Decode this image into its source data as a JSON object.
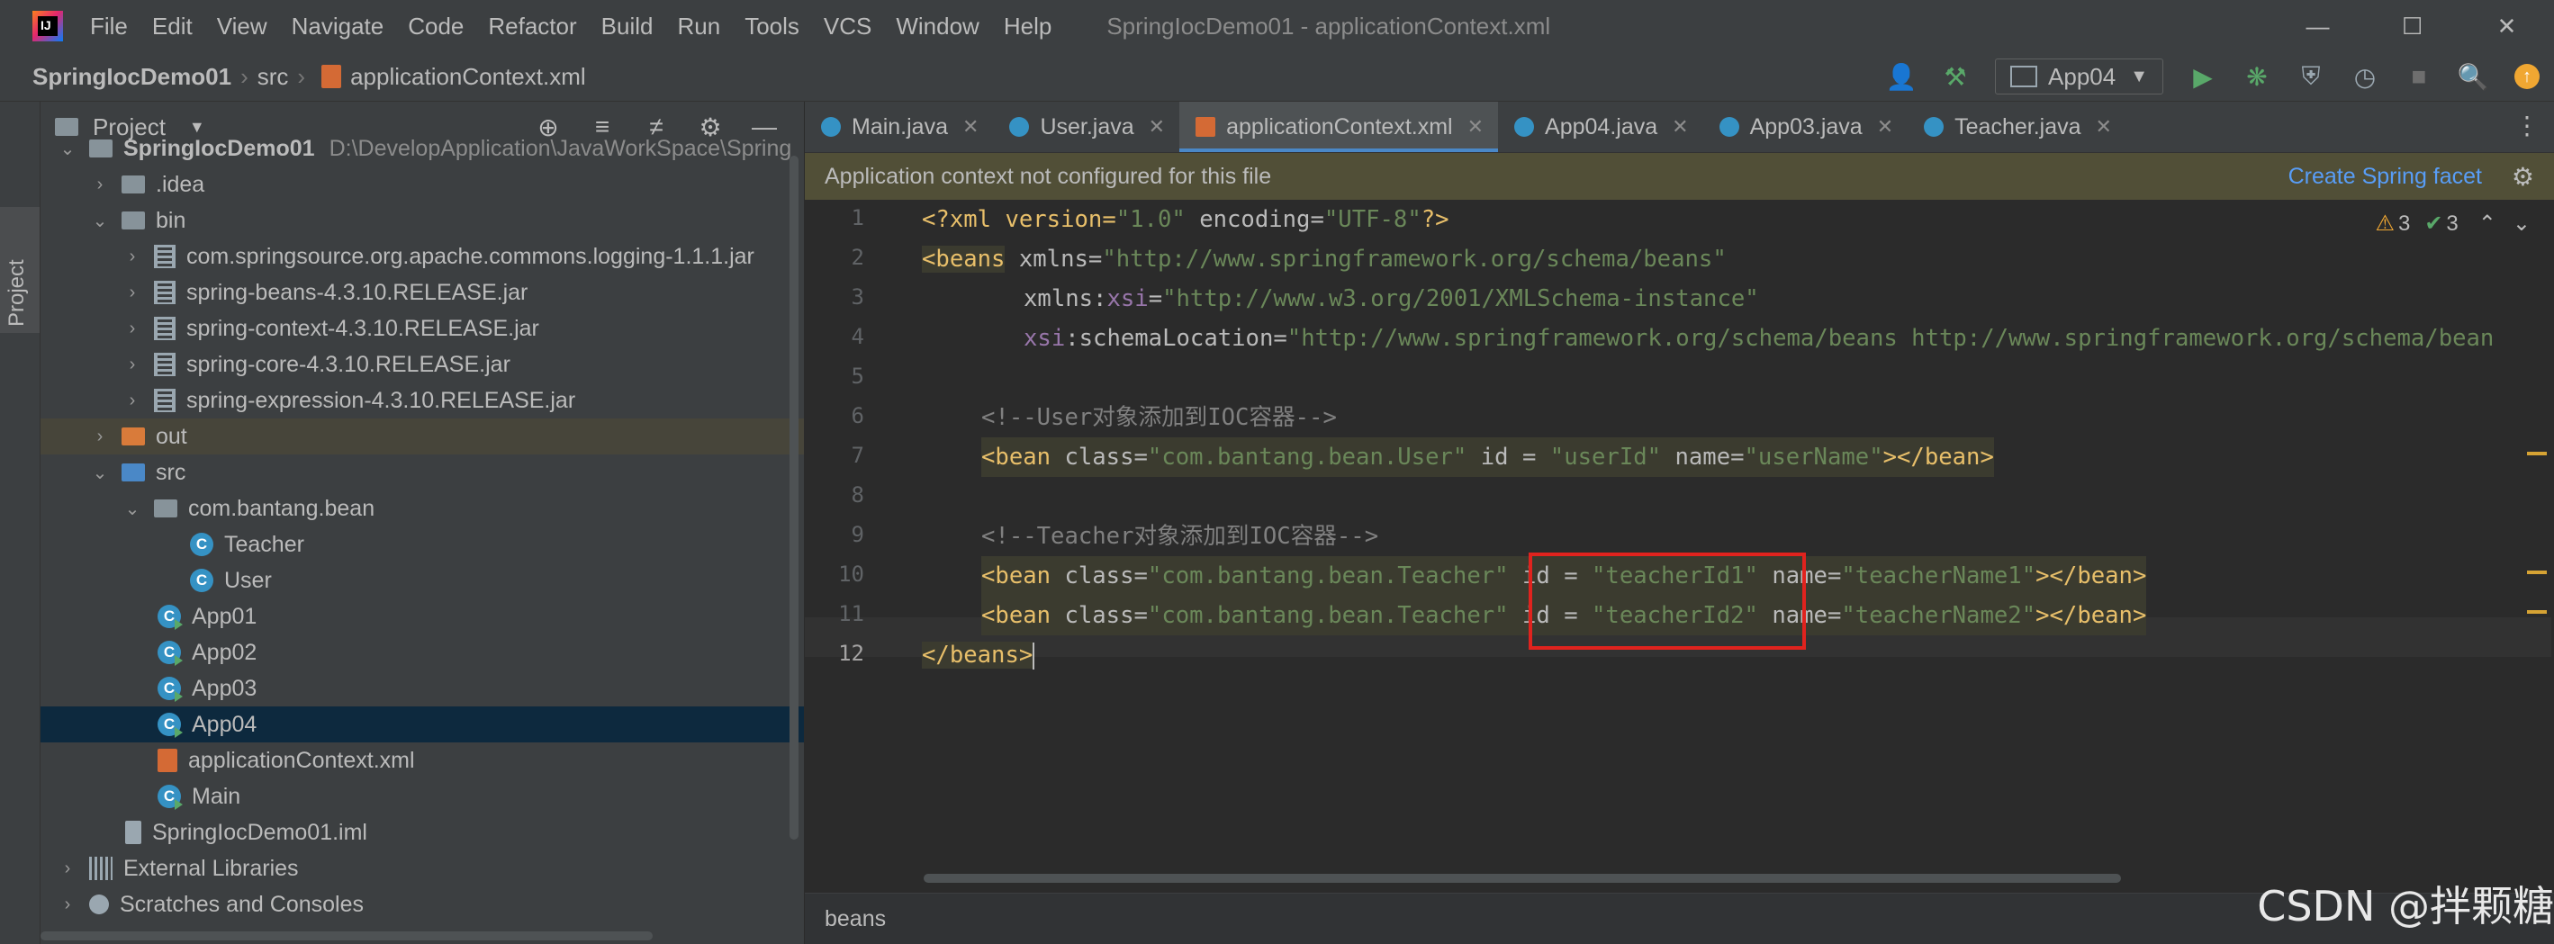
{
  "app": {
    "menu": [
      "File",
      "Edit",
      "View",
      "Navigate",
      "Code",
      "Refactor",
      "Build",
      "Run",
      "Tools",
      "VCS",
      "Window",
      "Help"
    ],
    "window_title": "SpringIocDemo01 - applicationContext.xml"
  },
  "nav": {
    "project": "SpringIocDemo01",
    "folder": "src",
    "file": "applicationContext.xml",
    "run_config": "App04"
  },
  "sidebar": {
    "tool_window_label": "Project",
    "panel_title": "Project",
    "tree": [
      {
        "label": "SpringIocDemo01",
        "hint": "D:\\DevelopApplication\\JavaWorkSpace\\Spring"
      },
      {
        "label": ".idea"
      },
      {
        "label": "bin"
      },
      {
        "label": "com.springsource.org.apache.commons.logging-1.1.1.jar"
      },
      {
        "label": "spring-beans-4.3.10.RELEASE.jar"
      },
      {
        "label": "spring-context-4.3.10.RELEASE.jar"
      },
      {
        "label": "spring-core-4.3.10.RELEASE.jar"
      },
      {
        "label": "spring-expression-4.3.10.RELEASE.jar"
      },
      {
        "label": "out"
      },
      {
        "label": "src"
      },
      {
        "label": "com.bantang.bean"
      },
      {
        "label": "Teacher"
      },
      {
        "label": "User"
      },
      {
        "label": "App01"
      },
      {
        "label": "App02"
      },
      {
        "label": "App03"
      },
      {
        "label": "App04"
      },
      {
        "label": "applicationContext.xml"
      },
      {
        "label": "Main"
      },
      {
        "label": "SpringIocDemo01.iml"
      },
      {
        "label": "External Libraries"
      },
      {
        "label": "Scratches and Consoles"
      }
    ]
  },
  "editor": {
    "tabs": [
      {
        "label": "Main.java"
      },
      {
        "label": "User.java"
      },
      {
        "label": "applicationContext.xml"
      },
      {
        "label": "App04.java"
      },
      {
        "label": "App03.java"
      },
      {
        "label": "Teacher.java"
      }
    ],
    "banner": {
      "message": "Application context not configured for this file",
      "action": "Create Spring facet"
    },
    "inspections": {
      "warnings": "3",
      "ok": "3"
    },
    "line_numbers": [
      "1",
      "2",
      "3",
      "4",
      "5",
      "6",
      "7",
      "8",
      "9",
      "10",
      "11",
      "12"
    ],
    "code": {
      "l1_open": "<?xml version=",
      "l1_v1": "\"1.0\"",
      "l1_mid": " encoding=",
      "l1_v2": "\"UTF-8\"",
      "l1_close": "?>",
      "l2_tag": "<beans",
      "l2_attr": " xmlns=",
      "l2_val": "\"http://www.springframework.org/schema/beans\"",
      "l3_attr1": "xmlns:",
      "l3_ns": "xsi",
      "l3_eq": "=",
      "l3_val": "\"http://www.w3.org/2001/XMLSchema-instance\"",
      "l4_ns": "xsi",
      "l4_attr": ":schemaLocation=",
      "l4_val": "\"http://www.springframework.org/schema/beans http://www.springframework.org/schema/bean",
      "l6": "<!--User对象添加到IOC容器-->",
      "l7_tag": "<bean",
      "l7_a1": " class=",
      "l7_v1": "\"com.bantang.bean.User\"",
      "l7_a2": " id = ",
      "l7_v2": "\"userId\"",
      "l7_a3": " name=",
      "l7_v3": "\"userName\"",
      "l7_close": "></bean>",
      "l9": "<!--Teacher对象添加到IOC容器-->",
      "l10_tag": "<bean",
      "l10_a1": " class=",
      "l10_v1": "\"com.bantang.bean.Teacher\"",
      "l10_a2": " id = ",
      "l10_v2": "\"teacherId1\"",
      "l10_a3": " name=",
      "l10_v3": "\"teacherName1\"",
      "l10_close": "></bean>",
      "l11_tag": "<bean",
      "l11_a1": " class=",
      "l11_v1": "\"com.bantang.bean.Teacher\"",
      "l11_a2": " id = ",
      "l11_v2": "\"teacherId2\"",
      "l11_a3": " name=",
      "l11_v3": "\"teacherName2\"",
      "l11_close": "></bean>",
      "l12": "</beans>"
    },
    "breadcrumb": "beans"
  },
  "watermark": "CSDN @拌颗糖"
}
